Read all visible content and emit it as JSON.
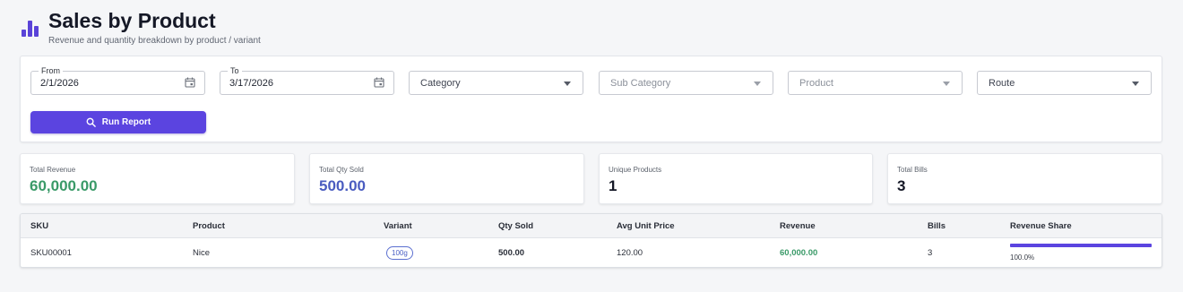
{
  "header": {
    "title": "Sales by Product",
    "subtitle": "Revenue and quantity breakdown by product / variant"
  },
  "filters": {
    "from": {
      "label": "From",
      "value": "2/1/2026"
    },
    "to": {
      "label": "To",
      "value": "3/17/2026"
    },
    "category": {
      "placeholder": "Category"
    },
    "sub_category": {
      "placeholder": "Sub Category"
    },
    "product": {
      "placeholder": "Product"
    },
    "route": {
      "placeholder": "Route"
    },
    "run_label": "Run Report"
  },
  "stats": [
    {
      "label": "Total Revenue",
      "value": "60,000.00",
      "color": "#3a9a68"
    },
    {
      "label": "Total Qty Sold",
      "value": "500.00",
      "color": "#4a5cc0"
    },
    {
      "label": "Unique Products",
      "value": "1",
      "color": "#151826"
    },
    {
      "label": "Total Bills",
      "value": "3",
      "color": "#151826"
    }
  ],
  "table": {
    "columns": [
      "SKU",
      "Product",
      "Variant",
      "Qty Sold",
      "Avg Unit Price",
      "Revenue",
      "Bills",
      "Revenue Share"
    ],
    "rows": [
      {
        "sku": "SKU00001",
        "product": "Nice",
        "variant": "100g",
        "qty_sold": "500.00",
        "avg_unit_price": "120.00",
        "revenue": "60,000.00",
        "bills": "3",
        "revenue_share_text": "100.0%",
        "revenue_share": 1.0
      }
    ]
  },
  "colors": {
    "accent": "#5b44e0",
    "revenue_green": "#3a9a68"
  },
  "icons": {
    "title": "bar-chart-icon",
    "date": "calendar-icon",
    "dropdown": "chevron-down-icon",
    "run": "search-icon"
  }
}
